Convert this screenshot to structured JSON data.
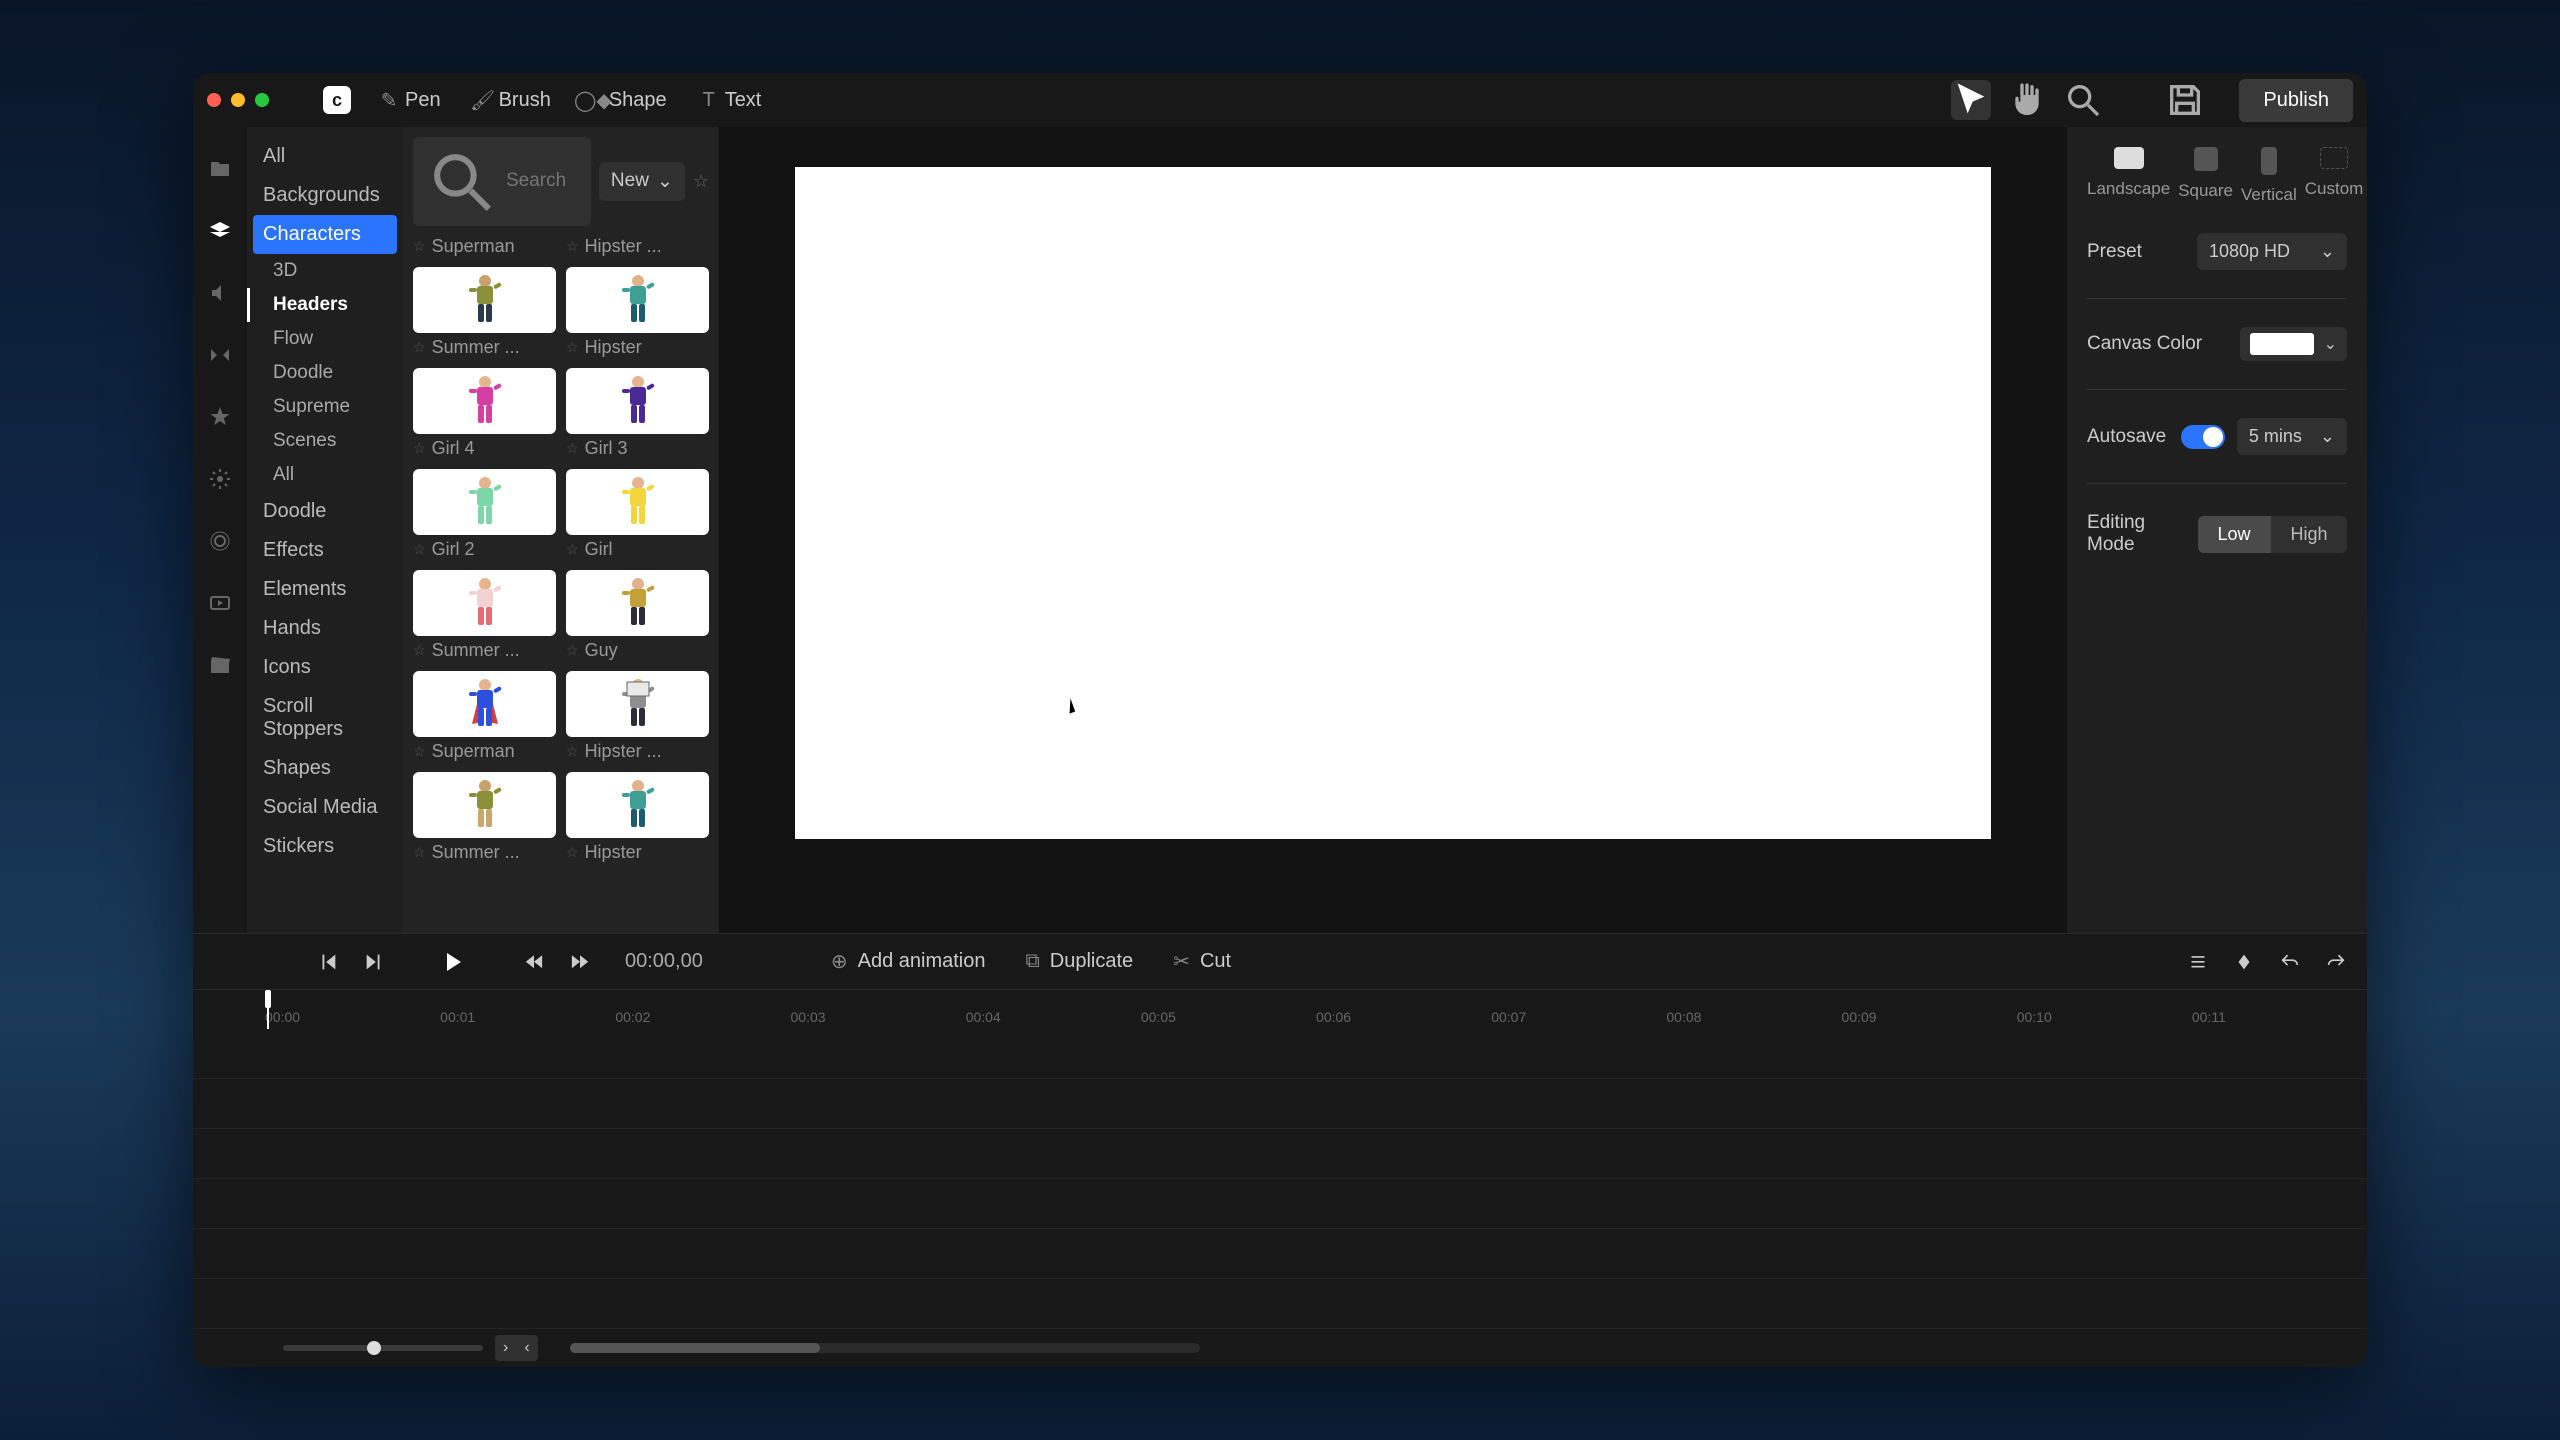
{
  "toolbar": {
    "tools": [
      {
        "icon": "pen",
        "label": "Pen"
      },
      {
        "icon": "brush",
        "label": "Brush"
      },
      {
        "icon": "shape",
        "label": "Shape"
      },
      {
        "icon": "text",
        "label": "Text"
      }
    ],
    "publish": "Publish"
  },
  "categories": {
    "top": [
      "All",
      "Backgrounds"
    ],
    "selected": "Characters",
    "subs": [
      {
        "label": "3D",
        "sel": false
      },
      {
        "label": "Headers",
        "sel": true
      },
      {
        "label": "Flow",
        "sel": false
      },
      {
        "label": "Doodle",
        "sel": false
      },
      {
        "label": "Supreme",
        "sel": false
      },
      {
        "label": "Scenes",
        "sel": false
      },
      {
        "label": "All",
        "sel": false
      }
    ],
    "rest": [
      "Doodle",
      "Effects",
      "Elements",
      "Hands",
      "Icons",
      "Scroll Stoppers",
      "Shapes",
      "Social Media",
      "Stickers"
    ]
  },
  "assets": {
    "search_placeholder": "Search",
    "sort": "New",
    "partial_row": [
      {
        "label": "Superman"
      },
      {
        "label": "Hipster ..."
      }
    ],
    "items": [
      {
        "label": "Summer ...",
        "pal": {
          "body": "#8a8f3a",
          "pants": "#2b3a4a",
          "skin": "#caa06d"
        }
      },
      {
        "label": "Hipster",
        "pal": {
          "body": "#3ea095",
          "pants": "#1d5d6b",
          "skin": "#e2b38a"
        }
      },
      {
        "label": "Girl 4",
        "pal": {
          "body": "#d63fa1",
          "pants": "#d63fa1",
          "skin": "#e6b590"
        }
      },
      {
        "label": "Girl 3",
        "pal": {
          "body": "#4b2a96",
          "pants": "#4b2a96",
          "skin": "#e6b590"
        }
      },
      {
        "label": "Girl 2",
        "pal": {
          "body": "#7cd6a8",
          "pants": "#7cd6a8",
          "skin": "#e6b590"
        }
      },
      {
        "label": "Girl",
        "pal": {
          "body": "#f2d63c",
          "pants": "#f2d63c",
          "skin": "#e6b590"
        }
      },
      {
        "label": "Summer ...",
        "pal": {
          "body": "#f0d2d2",
          "pants": "#e66d6d",
          "skin": "#e6b590"
        }
      },
      {
        "label": "Guy",
        "pal": {
          "body": "#c2a03a",
          "pants": "#2a2f37",
          "skin": "#e2b38a"
        }
      },
      {
        "label": "Superman",
        "pal": {
          "body": "#2d4fe0",
          "pants": "#2d4fe0",
          "skin": "#e6b590",
          "cape": "#d63f3f"
        }
      },
      {
        "label": "Hipster ...",
        "pal": {
          "body": "#8e8e8e",
          "pants": "#2a2f37",
          "skin": "#e2b38a",
          "sign": "#e9e9e9"
        }
      },
      {
        "label": "Summer ...",
        "pal": {
          "body": "#8a8f3a",
          "pants": "#c9a76a",
          "skin": "#caa06d"
        }
      },
      {
        "label": "Hipster",
        "pal": {
          "body": "#3ea095",
          "pants": "#1d5d6b",
          "skin": "#e2b38a"
        }
      }
    ]
  },
  "props": {
    "orientations": [
      {
        "label": "Landscape",
        "type": "ls",
        "sel": true
      },
      {
        "label": "Square",
        "type": "sq",
        "sel": false
      },
      {
        "label": "Vertical",
        "type": "vt",
        "sel": false
      },
      {
        "label": "Custom",
        "type": "cu",
        "sel": false
      }
    ],
    "preset_label": "Preset",
    "preset_value": "1080p HD",
    "canvas_color_label": "Canvas Color",
    "canvas_color": "#ffffff",
    "autosave_label": "Autosave",
    "autosave_on": true,
    "autosave_interval": "5 mins",
    "editing_mode_label": "Editing Mode",
    "editing_modes": [
      {
        "label": "Low",
        "sel": true
      },
      {
        "label": "High",
        "sel": false
      }
    ]
  },
  "timeline": {
    "timecode": "00:00,00",
    "actions": [
      {
        "icon": "plus",
        "label": "Add animation"
      },
      {
        "icon": "dup",
        "label": "Duplicate"
      },
      {
        "icon": "cut",
        "label": "Cut"
      }
    ],
    "ticks": [
      "00:00",
      "00:01",
      "00:02",
      "00:03",
      "00:04",
      "00:05",
      "00:06",
      "00:07",
      "00:08",
      "00:09",
      "00:10",
      "00:11"
    ]
  }
}
